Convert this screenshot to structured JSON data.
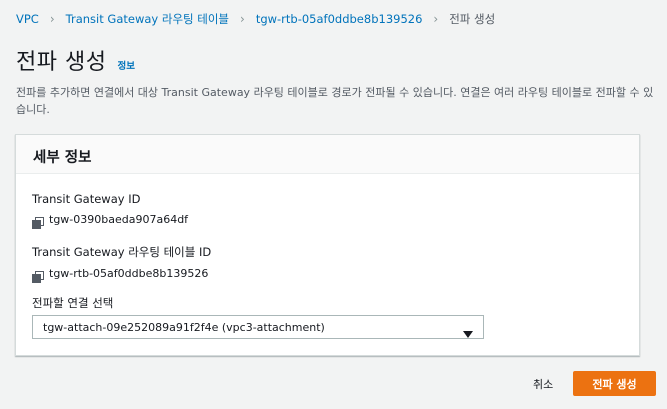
{
  "breadcrumb": {
    "items": [
      "VPC",
      "Transit Gateway 라우팅 테이블",
      "tgw-rtb-05af0ddbe8b139526"
    ],
    "current": "전파 생성"
  },
  "header": {
    "title": "전파 생성",
    "info_label": "정보"
  },
  "description": "전파를 추가하면 연결에서 대상 Transit Gateway 라우팅 테이블로 경로가 전파될 수 있습니다. 연결은 여러 라우팅 테이블로 전파할 수 있습니다.",
  "panel": {
    "title": "세부 정보",
    "fields": [
      {
        "label": "Transit Gateway ID",
        "value": "tgw-0390baeda907a64df",
        "icon": "copy-icon"
      },
      {
        "label": "Transit Gateway 라우팅 테이블 ID",
        "value": "tgw-rtb-05af0ddbe8b139526",
        "icon": "copy-icon"
      }
    ],
    "select": {
      "label": "전파할 연결 선택",
      "value": "tgw-attach-09e252089a91f2f4e (vpc3-attachment)"
    }
  },
  "footer": {
    "cancel_label": "취소",
    "submit_label": "전파 생성"
  },
  "colors": {
    "accent": "#ec7211",
    "link": "#0073bb",
    "background": "#f2f3f3"
  }
}
